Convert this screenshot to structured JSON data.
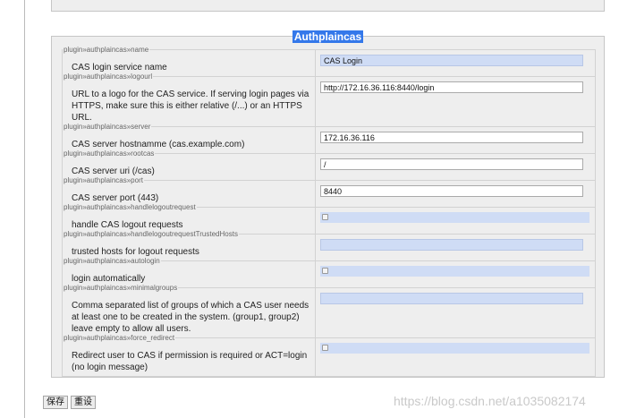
{
  "section": {
    "title": "Authplaincas"
  },
  "fields": [
    {
      "key": "plugin»authplaincas»name",
      "label": "CAS login service name",
      "type": "text",
      "value": "CAS Login",
      "highlighted": true
    },
    {
      "key": "plugin»authplaincas»logourl",
      "label": "URL to a logo for the CAS service. If serving login pages via HTTPS, make sure this is either relative (/...) or an HTTPS URL.",
      "type": "text",
      "value": "http://172.16.36.116:8440/login",
      "highlighted": false
    },
    {
      "key": "plugin»authplaincas»server",
      "label": "CAS server hostnamme (cas.example.com)",
      "type": "text",
      "value": "172.16.36.116",
      "highlighted": false
    },
    {
      "key": "plugin»authplaincas»rootcas",
      "label": "CAS server uri (/cas)",
      "type": "text",
      "value": "/",
      "highlighted": false
    },
    {
      "key": "plugin»authplaincas»port",
      "label": "CAS server port (443)",
      "type": "text",
      "value": "8440",
      "highlighted": false
    },
    {
      "key": "plugin»authplaincas»handlelogoutrequest",
      "label": "handle CAS logout requests",
      "type": "checkbox",
      "checked": false
    },
    {
      "key": "plugin»authplaincas»handlelogoutrequestTrustedHosts",
      "label": "trusted hosts for logout requests",
      "type": "text",
      "value": "",
      "highlighted": true
    },
    {
      "key": "plugin»authplaincas»autologin",
      "label": "login automatically",
      "type": "checkbox",
      "checked": false
    },
    {
      "key": "plugin»authplaincas»minimalgroups",
      "label": "Comma separated list of groups of which a CAS user needs at least one to be created in the system. (group1, group2) leave empty to allow all users.",
      "type": "text",
      "value": "",
      "highlighted": true
    },
    {
      "key": "plugin»authplaincas»force_redirect",
      "label": "Redirect user to CAS if permission is required or ACT=login (no login message)",
      "type": "checkbox",
      "checked": false
    }
  ],
  "buttons": {
    "save_label": "保存",
    "reset_label": "重设"
  },
  "watermark": "https://blog.csdn.net/a1035082174",
  "colors": {
    "title_bg": "#3478ea",
    "field_highlight": "#cfdcf5",
    "panel_bg": "#eeeeee"
  }
}
